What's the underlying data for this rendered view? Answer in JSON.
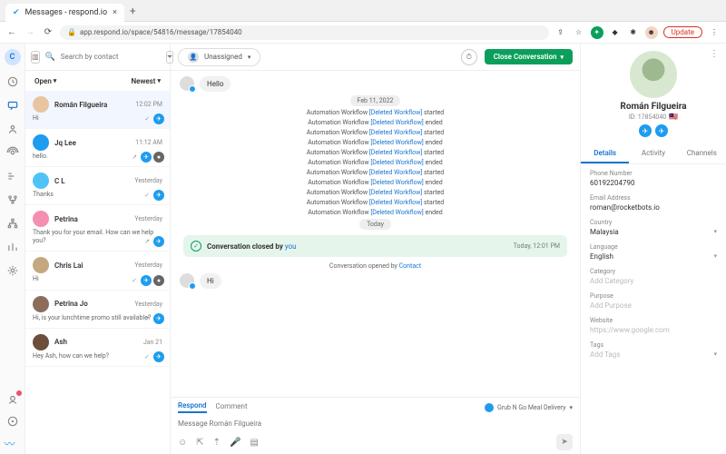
{
  "browser": {
    "tab_title": "Messages - respond.io",
    "url": "app.respond.io/space/54816/message/17854040",
    "update": "Update"
  },
  "rail": {
    "avatar_initial": "C"
  },
  "inbox": {
    "search_placeholder": "Search by contact",
    "filter_open": "Open",
    "filter_newest": "Newest",
    "items": [
      {
        "name": "Román Filgueira",
        "time": "12:02 PM",
        "snippet": "Hi",
        "av_bg": "#e8c5a0"
      },
      {
        "name": "Jq Lee",
        "time": "11:12 AM",
        "snippet": "hello.",
        "av_bg": "#1e9cef"
      },
      {
        "name": "C L",
        "time": "Yesterday",
        "snippet": "Thanks",
        "av_bg": "#4fc3f7"
      },
      {
        "name": "Petrina",
        "time": "Yesterday",
        "snippet": "Thank you for your email. How can we help you?",
        "av_bg": "#f48fb1"
      },
      {
        "name": "Chris Lai",
        "time": "Yesterday",
        "snippet": "Hi",
        "av_bg": "#c5a880"
      },
      {
        "name": "Petrina Jo",
        "time": "Yesterday",
        "snippet": "Hi, is your lunchtime promo still available?",
        "av_bg": "#8c6d5c"
      },
      {
        "name": "Ash",
        "time": "Jan 21",
        "snippet": "Hey Ash, how can we help?",
        "av_bg": "#6b4f3a"
      }
    ]
  },
  "chat": {
    "assignee_label": "Unassigned",
    "close_label": "Close Conversation",
    "incoming1": "Hello",
    "date_pill": "Feb 11, 2022",
    "auto_prefix": "Automation Workflow ",
    "auto_link": "[Deleted Workflow]",
    "auto_events": [
      "started",
      "ended",
      "started",
      "ended",
      "started",
      "ended",
      "started",
      "ended",
      "started",
      "started",
      "ended"
    ],
    "today_pill": "Today",
    "closed_text": "Conversation closed by ",
    "closed_by": "you",
    "closed_time": "Today, 12:01 PM",
    "opened_text": "Conversation opened by ",
    "opened_by": "Contact",
    "incoming2": "Hi",
    "compose": {
      "tab_respond": "Respond",
      "tab_comment": "Comment",
      "channel": "Grub N Go Meal Delivery",
      "placeholder": "Message Román Filgueira"
    }
  },
  "detail": {
    "name": "Román Filgueira",
    "id_label": "ID: 17854040",
    "tabs": {
      "details": "Details",
      "activity": "Activity",
      "channels": "Channels"
    },
    "fields": {
      "phone_label": "Phone Number",
      "phone": "60192204790",
      "email_label": "Email Address",
      "email": "roman@rocketbots.io",
      "country_label": "Country",
      "country": "Malaysia",
      "language_label": "Language",
      "language": "English",
      "category_label": "Category",
      "category_ph": "Add Category",
      "purpose_label": "Purpose",
      "purpose_ph": "Add Purpose",
      "website_label": "Website",
      "website_ph": "https://www.google.com",
      "tags_label": "Tags",
      "tags_ph": "Add Tags"
    }
  }
}
